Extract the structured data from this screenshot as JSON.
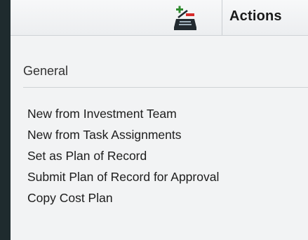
{
  "toolbar": {
    "actions_icon": "tasks-icon",
    "actions_label": "Actions"
  },
  "general": {
    "title": "General",
    "items": [
      {
        "label": "New from Investment Team"
      },
      {
        "label": "New from Task Assignments"
      },
      {
        "label": "Set as Plan of Record"
      },
      {
        "label": "Submit Plan of Record for Approval"
      },
      {
        "label": "Copy Cost Plan"
      }
    ]
  },
  "colors": {
    "background": "#1f2b2e",
    "panel": "#f2f3f4",
    "icon_green": "#2e8b2e",
    "icon_red": "#d62b2b",
    "icon_dark": "#222a30"
  }
}
